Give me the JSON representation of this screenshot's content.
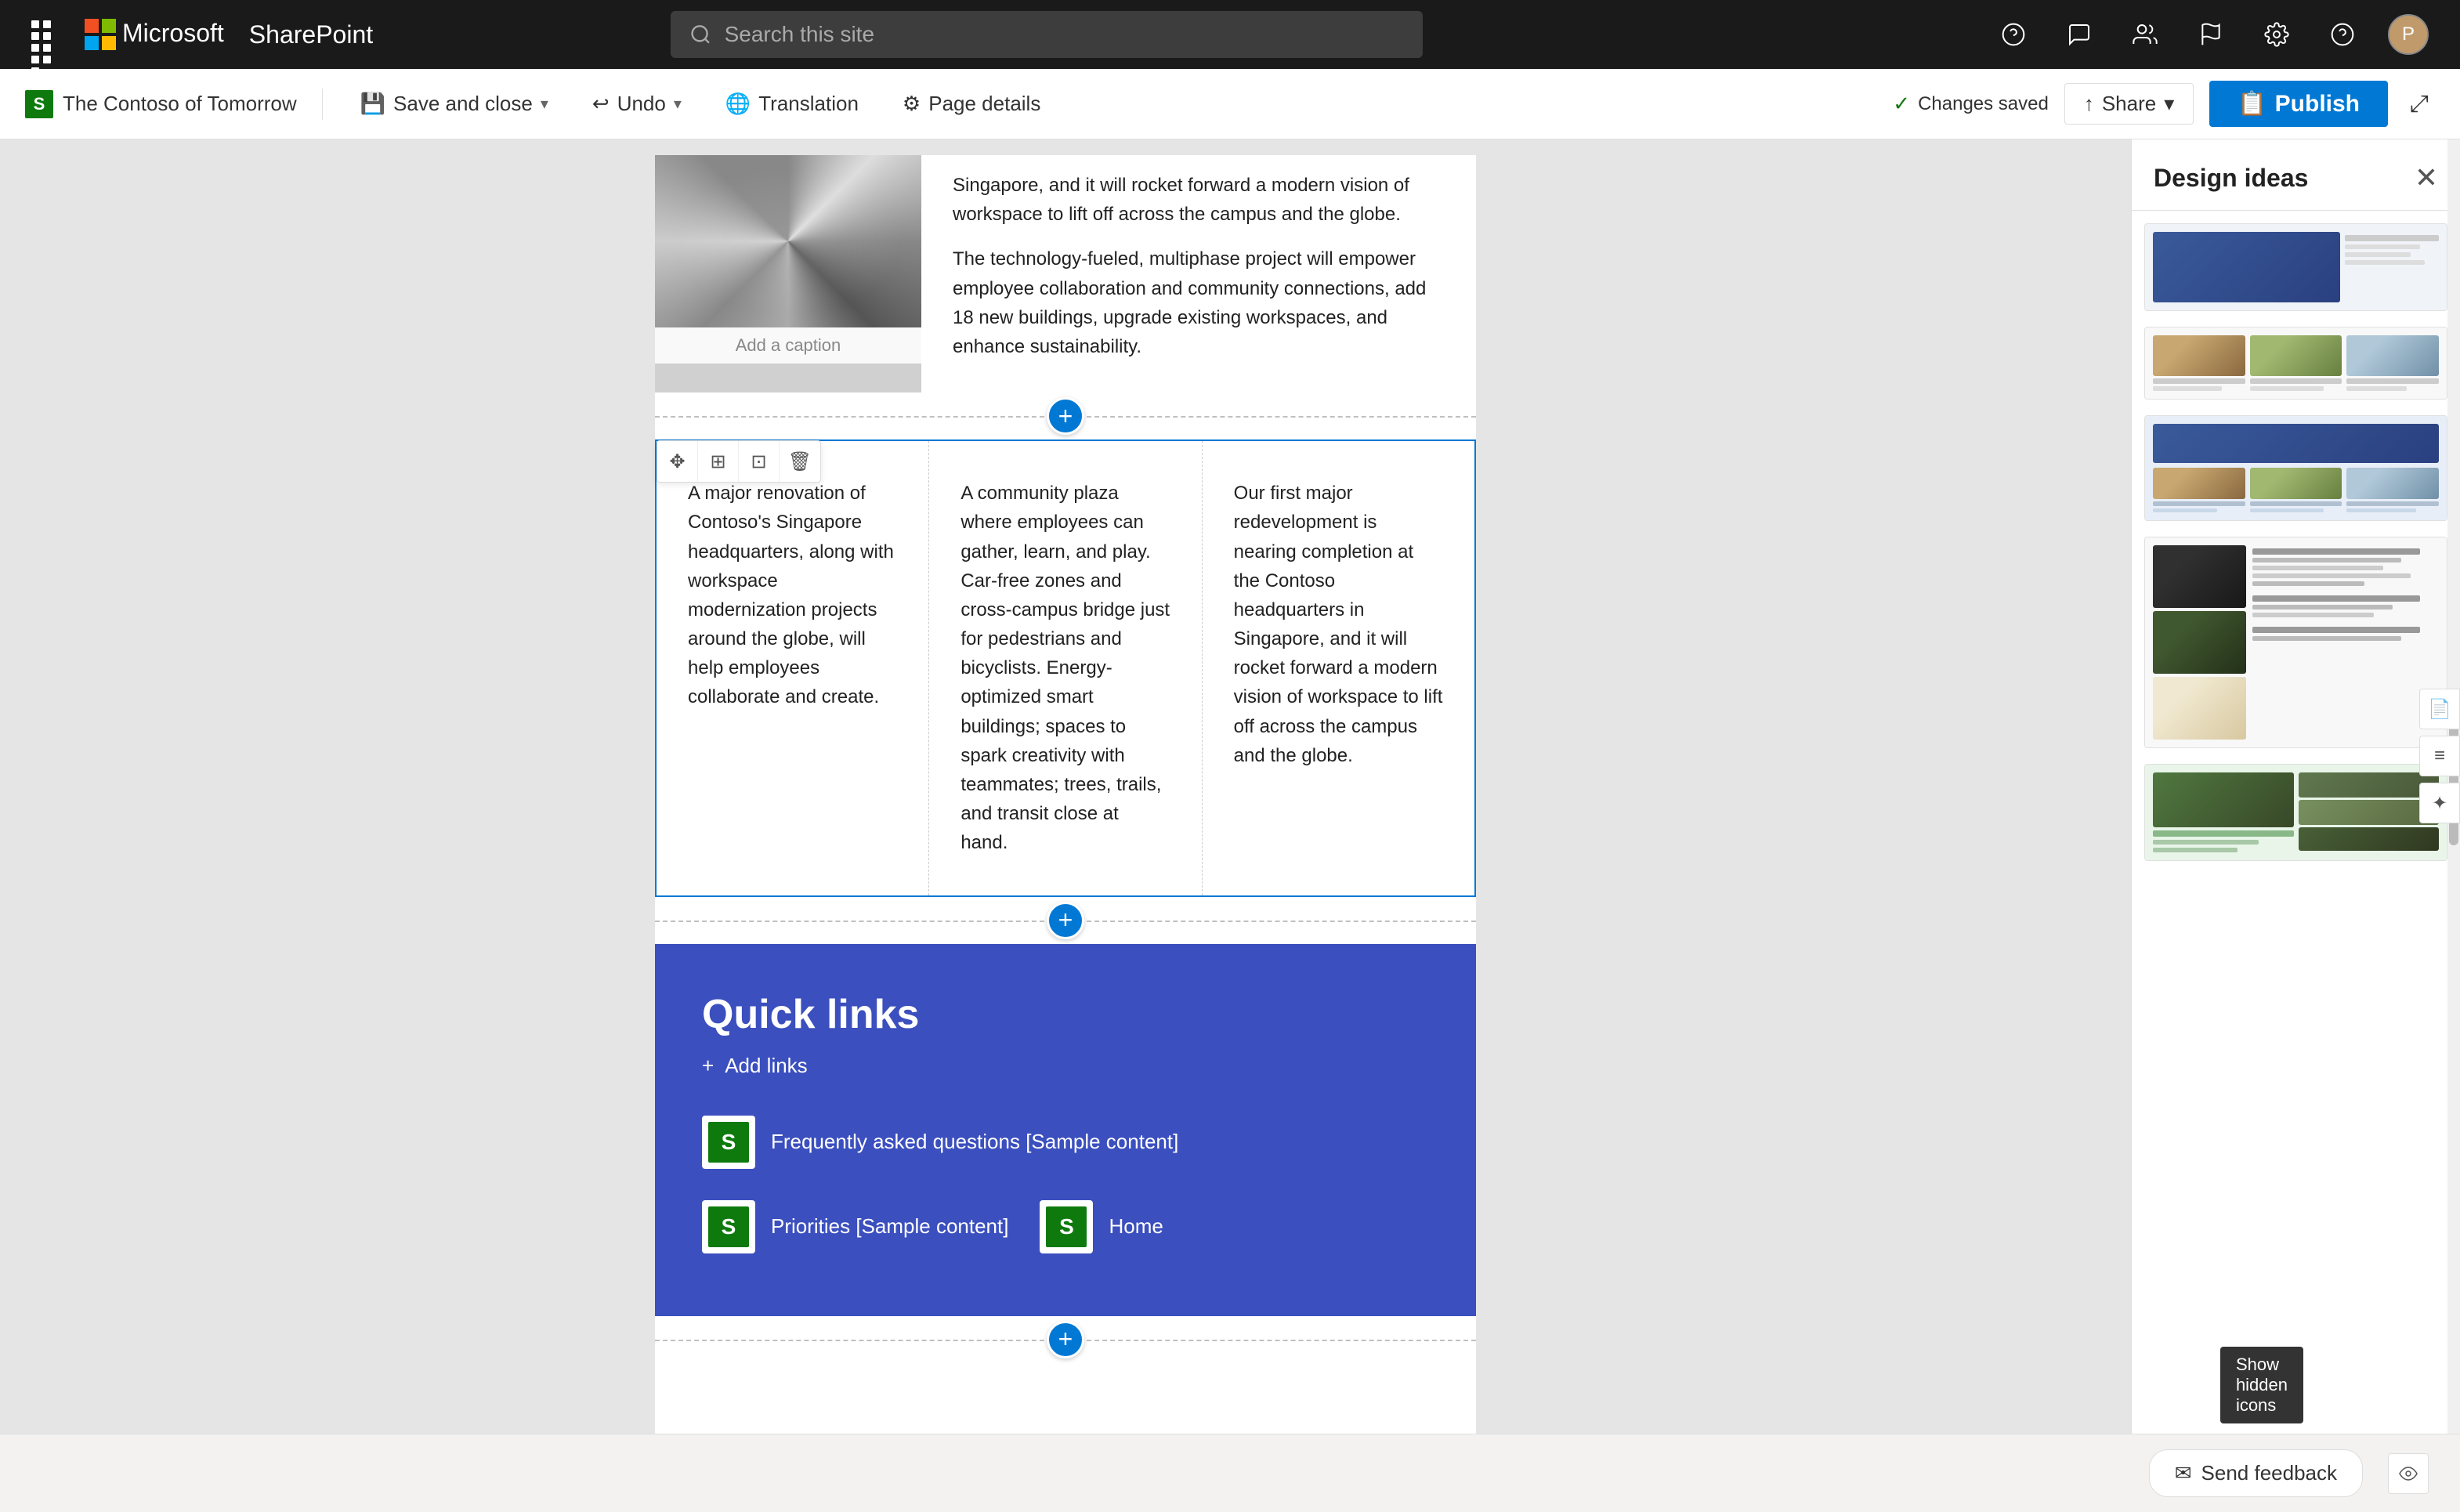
{
  "topnav": {
    "app_name": "Microsoft",
    "product": "SharePoint",
    "search_placeholder": "Search this site",
    "icons": [
      "help-circle",
      "chat",
      "people",
      "flag",
      "settings",
      "question"
    ]
  },
  "toolbar": {
    "brand_label": "The Contoso of Tomorrow",
    "save_label": "Save and close",
    "undo_label": "Undo",
    "translation_label": "Translation",
    "page_details_label": "Page details",
    "changes_saved_label": "Changes saved",
    "share_label": "Share",
    "publish_label": "Publish"
  },
  "editor": {
    "image_caption": "Add a caption",
    "paragraph1": "Singapore, and it will rocket forward a modern vision of workspace to lift off across the campus and the globe.",
    "paragraph2": "The technology-fueled, multiphase project will empower employee collaboration and community connections, add 18 new buildings, upgrade existing workspaces, and enhance sustainability.",
    "col1": "A major renovation of Contoso's Singapore headquarters, along with workspace modernization projects around the globe, will help employees collaborate and create.",
    "col2": "A community plaza where employees can gather, learn, and play. Car-free zones and cross-campus bridge just for pedestrians and bicyclists. Energy-optimized smart buildings; spaces to spark creativity with teammates; trees, trails, and transit close at hand.",
    "col3": "Our first major redevelopment is nearing completion at the Contoso headquarters in Singapore, and it will rocket forward a modern vision of workspace to lift off across the campus and the globe.",
    "quick_links_title": "Quick links",
    "add_links_label": "Add links",
    "link1_label": "Frequently asked questions [Sample content]",
    "link2_label": "Priorities [Sample content]",
    "link3_label": "Home"
  },
  "design_panel": {
    "title": "Design ideas",
    "show_hidden_tooltip": "Show hidden icons"
  },
  "feedback": {
    "label": "Send feedback"
  },
  "section_toolbar": {
    "move": "✥",
    "adjust": "⊞",
    "copy": "⊡",
    "delete": "🗑"
  }
}
